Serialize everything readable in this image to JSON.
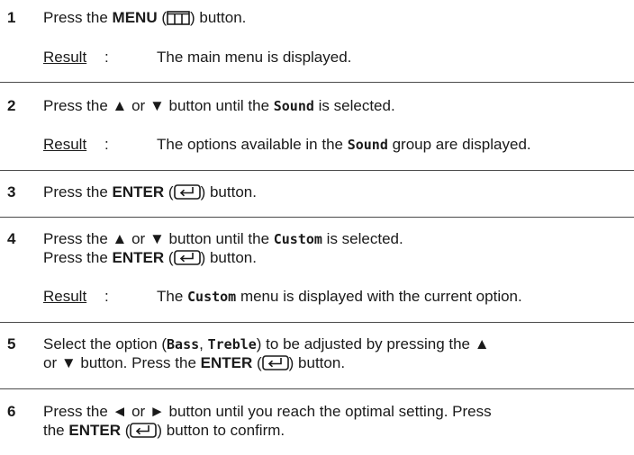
{
  "steps": [
    {
      "number": "1",
      "text_a": "Press the ",
      "menu_word": "MENU",
      "text_b": " button.",
      "menu_icon": "menu-grid-icon",
      "result_label": "Result",
      "result_text": "The main menu is displayed."
    },
    {
      "number": "2",
      "text_a": "Press the ",
      "up_arrow": "▲",
      "or_word": " or ",
      "down_arrow": "▼",
      "text_b": " button until the ",
      "sound_word": "Sound",
      "text_c": " is selected.",
      "result_label": "Result",
      "result_text_a": "The options available in the ",
      "result_sound_word": "Sound",
      "result_text_b": " group are displayed."
    },
    {
      "number": "3",
      "text_a": "Press the ",
      "enter_word": "ENTER",
      "text_b": " button.",
      "enter_icon": "enter-icon"
    },
    {
      "number": "4",
      "text_a": "Press the ",
      "up_arrow": "▲",
      "or_word": " or ",
      "down_arrow": "▼",
      "text_b": " button until the ",
      "custom_word": "Custom",
      "text_c": " is selected.",
      "line2_a": "Press the ",
      "enter_word": "ENTER",
      "line2_b": " button.",
      "result_label": "Result",
      "result_text_a": "The ",
      "result_custom_word": "Custom",
      "result_text_b": " menu is displayed with the current option."
    },
    {
      "number": "5",
      "text_a": "Select the option (",
      "bass_word": "Bass",
      "comma": ", ",
      "treble_word": "Treble",
      "text_b": ") to be adjusted by pressing the ",
      "up_arrow": "▲",
      "line2_a": "or ",
      "down_arrow": "▼",
      "line2_b": " button. Press the ",
      "enter_word": "ENTER",
      "line2_c": " button."
    },
    {
      "number": "6",
      "text_a": "Press the ",
      "left_arrow": "◄",
      "or_word": " or ",
      "right_arrow": "►",
      "text_b": " button until you reach the optimal setting. Press",
      "line2_a": "the ",
      "enter_word": "ENTER",
      "line2_b": " button to confirm."
    }
  ],
  "colors": {
    "text": "#1a1a1a",
    "rule": "#4a4a4a"
  }
}
